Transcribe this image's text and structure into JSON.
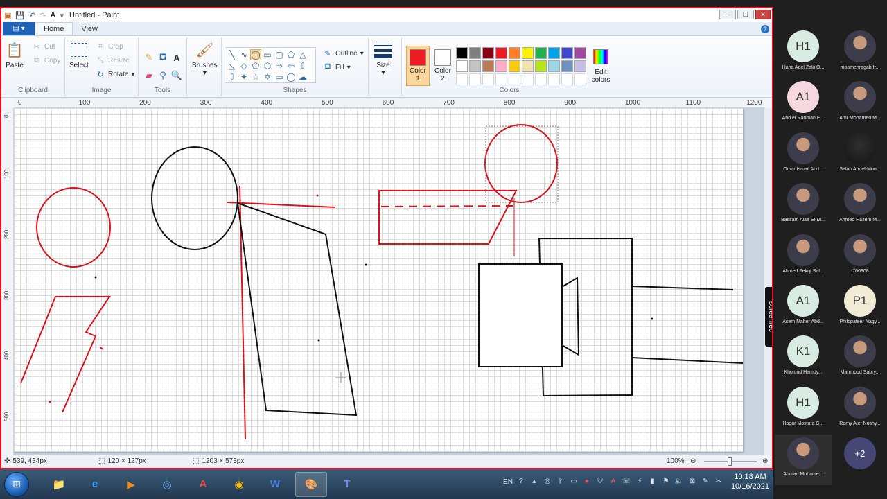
{
  "window": {
    "title": "Untitled - Paint",
    "controls": [
      "─",
      "❐",
      "✕"
    ]
  },
  "tabs": {
    "file": "▤ ▾",
    "home": "Home",
    "view": "View"
  },
  "clipboard": {
    "paste": "Paste",
    "cut": "Cut",
    "copy": "Copy",
    "label": "Clipboard"
  },
  "image": {
    "select": "Select",
    "crop": "Crop",
    "resize": "Resize",
    "rotate": "Rotate",
    "label": "Image"
  },
  "tools": {
    "label": "Tools"
  },
  "brushes": {
    "label": "Brushes"
  },
  "shapes": {
    "outline": "Outline",
    "fill": "Fill",
    "label": "Shapes"
  },
  "size": {
    "label": "Size"
  },
  "colors": {
    "label": "Colors",
    "color1_label": "Color 1",
    "color2_label": "Color 2",
    "edit_label": "Edit colors",
    "color1": "#ed1c24",
    "color2": "#ffffff",
    "palette": [
      "#000000",
      "#7f7f7f",
      "#880015",
      "#ed1c24",
      "#ff7f27",
      "#fff200",
      "#22b14c",
      "#00a2e8",
      "#3f48cc",
      "#a349a4",
      "#ffffff",
      "#c3c3c3",
      "#b97a57",
      "#ffaec9",
      "#ffc90e",
      "#efe4b0",
      "#b5e61d",
      "#99d9ea",
      "#7092be",
      "#c8bfe7",
      "#ffffff",
      "#ffffff",
      "#ffffff",
      "#ffffff",
      "#ffffff",
      "#ffffff",
      "#ffffff",
      "#ffffff",
      "#ffffff",
      "#ffffff"
    ]
  },
  "ruler": {
    "top": [
      "0",
      "100",
      "200",
      "300",
      "400",
      "500",
      "600",
      "700",
      "800",
      "900",
      "1000",
      "1100",
      "1200"
    ],
    "left": [
      "0",
      "100",
      "200",
      "300",
      "400",
      "500"
    ]
  },
  "status": {
    "cursor": "539, 434px",
    "selection": "120 × 127px",
    "canvas_size": "1203 × 573px",
    "zoom": "100%"
  },
  "taskbar": {
    "apps": [
      "📁",
      "e",
      "▶",
      "◎",
      "A",
      "◉",
      "W",
      "🎨",
      "T"
    ],
    "language": "EN",
    "time": "10:18 AM",
    "date": "10/16/2021"
  },
  "screenrec": "screenrec",
  "participants": [
    {
      "initials": "H1",
      "name": "Hana Adel Zaki O...",
      "kind": "init"
    },
    {
      "initials": "",
      "name": "moamenragab fr...",
      "kind": "photo"
    },
    {
      "initials": "A1",
      "name": "Abd el Rahman E...",
      "kind": "init-pink"
    },
    {
      "initials": "",
      "name": "Amr Mohamed M...",
      "kind": "photo"
    },
    {
      "initials": "",
      "name": "Omar Ismail Abd...",
      "kind": "photo"
    },
    {
      "initials": "",
      "name": "Salah Abdel-Mon...",
      "kind": "dark"
    },
    {
      "initials": "",
      "name": "Bassam Alaa El-Di...",
      "kind": "photo"
    },
    {
      "initials": "",
      "name": "Ahmed Hazem M...",
      "kind": "photo"
    },
    {
      "initials": "",
      "name": "Ahmed Fekry Sal...",
      "kind": "photo"
    },
    {
      "initials": "",
      "name": "t700908",
      "kind": "photo"
    },
    {
      "initials": "A1",
      "name": "Asem Maher Abd...",
      "kind": "init"
    },
    {
      "initials": "P1",
      "name": "Philopateer Nagy...",
      "kind": "init-cream"
    },
    {
      "initials": "K1",
      "name": "Kholoud Hamdy...",
      "kind": "init"
    },
    {
      "initials": "",
      "name": "Mahmoud Sabry...",
      "kind": "photo"
    },
    {
      "initials": "H1",
      "name": "Hagar Mostafa G...",
      "kind": "init"
    },
    {
      "initials": "",
      "name": "Ramy Atef Noshy...",
      "kind": "photo"
    },
    {
      "initials": "",
      "name": "Ahmad Mohame...",
      "kind": "photo"
    }
  ],
  "more_participants": "+2"
}
